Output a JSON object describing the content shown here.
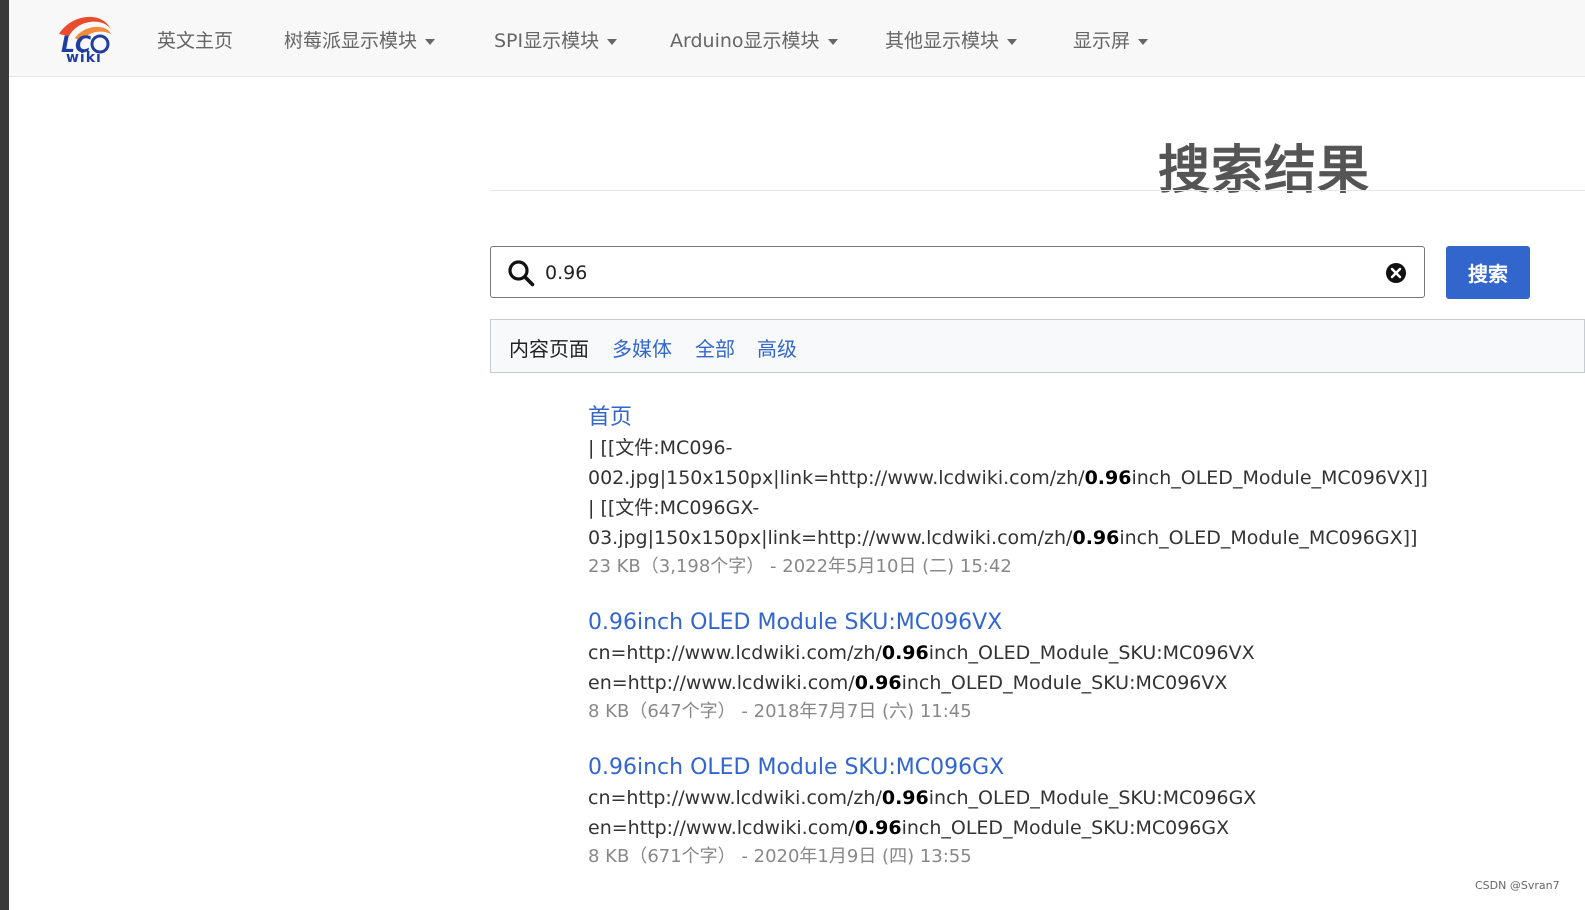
{
  "nav": {
    "logo_text": "wiki",
    "items": [
      {
        "label": "英文主页",
        "dropdown": false
      },
      {
        "label": "树莓派显示模块",
        "dropdown": true
      },
      {
        "label": "SPI显示模块",
        "dropdown": true
      },
      {
        "label": "Arduino显示模块",
        "dropdown": true
      },
      {
        "label": "其他显示模块",
        "dropdown": true
      },
      {
        "label": "显示屏",
        "dropdown": true
      }
    ]
  },
  "page": {
    "title": "搜索结果"
  },
  "search": {
    "value": "0.96",
    "button_label": "搜索"
  },
  "filters": [
    "内容页面",
    "多媒体",
    "全部",
    "高级"
  ],
  "results": [
    {
      "title": "首页",
      "lines": [
        {
          "pre": "| [[文件:MC096-",
          "bold": "",
          "post": ""
        },
        {
          "pre": "002.jpg|150x150px|link=http://www.lcdwiki.com/zh/",
          "bold": "0.96",
          "post": "inch_OLED_Module_MC096VX]]"
        },
        {
          "pre": "| [[文件:MC096GX-",
          "bold": "",
          "post": ""
        },
        {
          "pre": "03.jpg|150x150px|link=http://www.lcdwiki.com/zh/",
          "bold": "0.96",
          "post": "inch_OLED_Module_MC096GX]]"
        }
      ],
      "meta": "23 KB（3,198个字） - 2022年5月10日 (二) 15:42"
    },
    {
      "title": "0.96inch OLED Module SKU:MC096VX",
      "lines": [
        {
          "pre": "cn=http://www.lcdwiki.com/zh/",
          "bold": "0.96",
          "post": "inch_OLED_Module_SKU:MC096VX"
        },
        {
          "pre": "en=http://www.lcdwiki.com/",
          "bold": "0.96",
          "post": "inch_OLED_Module_SKU:MC096VX"
        }
      ],
      "meta": "8 KB（647个字） - 2018年7月7日 (六) 11:45"
    },
    {
      "title": "0.96inch OLED Module SKU:MC096GX",
      "lines": [
        {
          "pre": "cn=http://www.lcdwiki.com/zh/",
          "bold": "0.96",
          "post": "inch_OLED_Module_SKU:MC096GX"
        },
        {
          "pre": "en=http://www.lcdwiki.com/",
          "bold": "0.96",
          "post": "inch_OLED_Module_SKU:MC096GX"
        }
      ],
      "meta": "8 KB（671个字） - 2020年1月9日 (四) 13:55"
    }
  ],
  "watermark": "CSDN @Svran7"
}
